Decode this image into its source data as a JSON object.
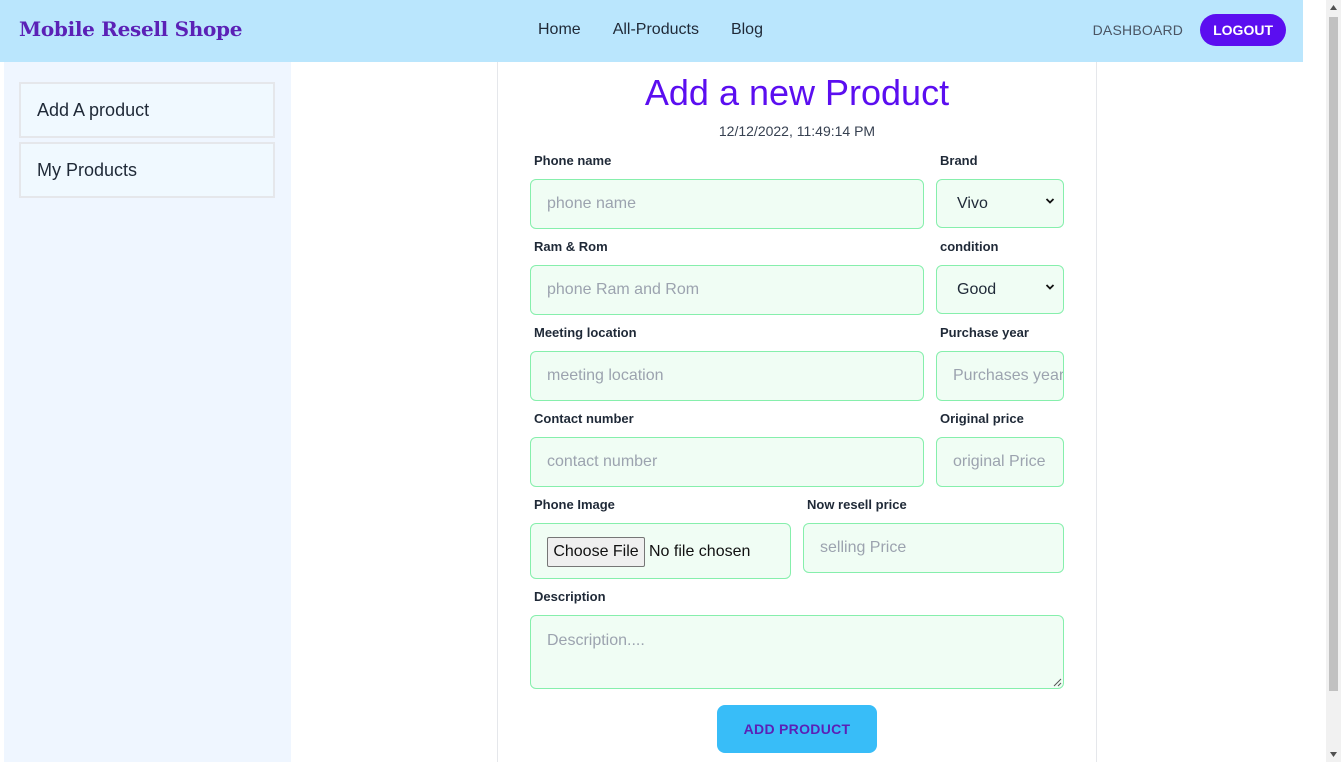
{
  "navbar": {
    "brand": "Mobile Resell Shope",
    "links": [
      "Home",
      "All-Products",
      "Blog"
    ],
    "dashboard_label": "DASHBOARD",
    "logout_label": "LOGOUT"
  },
  "sidebar": {
    "items": [
      {
        "label": "Add A product"
      },
      {
        "label": "My Products"
      }
    ]
  },
  "form": {
    "title": "Add a new Product",
    "datetime": "12/12/2022, 11:49:14 PM",
    "phone_name": {
      "label": "Phone name",
      "placeholder": "phone name"
    },
    "brand": {
      "label": "Brand",
      "value": "Vivo"
    },
    "ram_rom": {
      "label": "Ram & Rom",
      "placeholder": "phone Ram and Rom"
    },
    "condition": {
      "label": "condition",
      "value": "Good"
    },
    "meeting_location": {
      "label": "Meeting location",
      "placeholder": "meeting location"
    },
    "purchase_year": {
      "label": "Purchase year",
      "placeholder": "Purchases year"
    },
    "contact_number": {
      "label": "Contact number",
      "placeholder": "contact number"
    },
    "original_price": {
      "label": "Original price",
      "placeholder": "original Price"
    },
    "phone_image": {
      "label": "Phone Image",
      "button_label": "Choose File",
      "status": "No file chosen"
    },
    "resell_price": {
      "label": "Now resell price",
      "placeholder": "selling Price"
    },
    "description": {
      "label": "Description",
      "placeholder": "Description...."
    },
    "submit_label": "ADD PRODUCT"
  },
  "colors": {
    "navbar_bg": "#bae6fd",
    "brand": "#5b21b6",
    "accent": "#5b0ef0",
    "field_bg": "#f0fdf4",
    "field_border": "#86efac",
    "submit_bg": "#38bdf8"
  }
}
